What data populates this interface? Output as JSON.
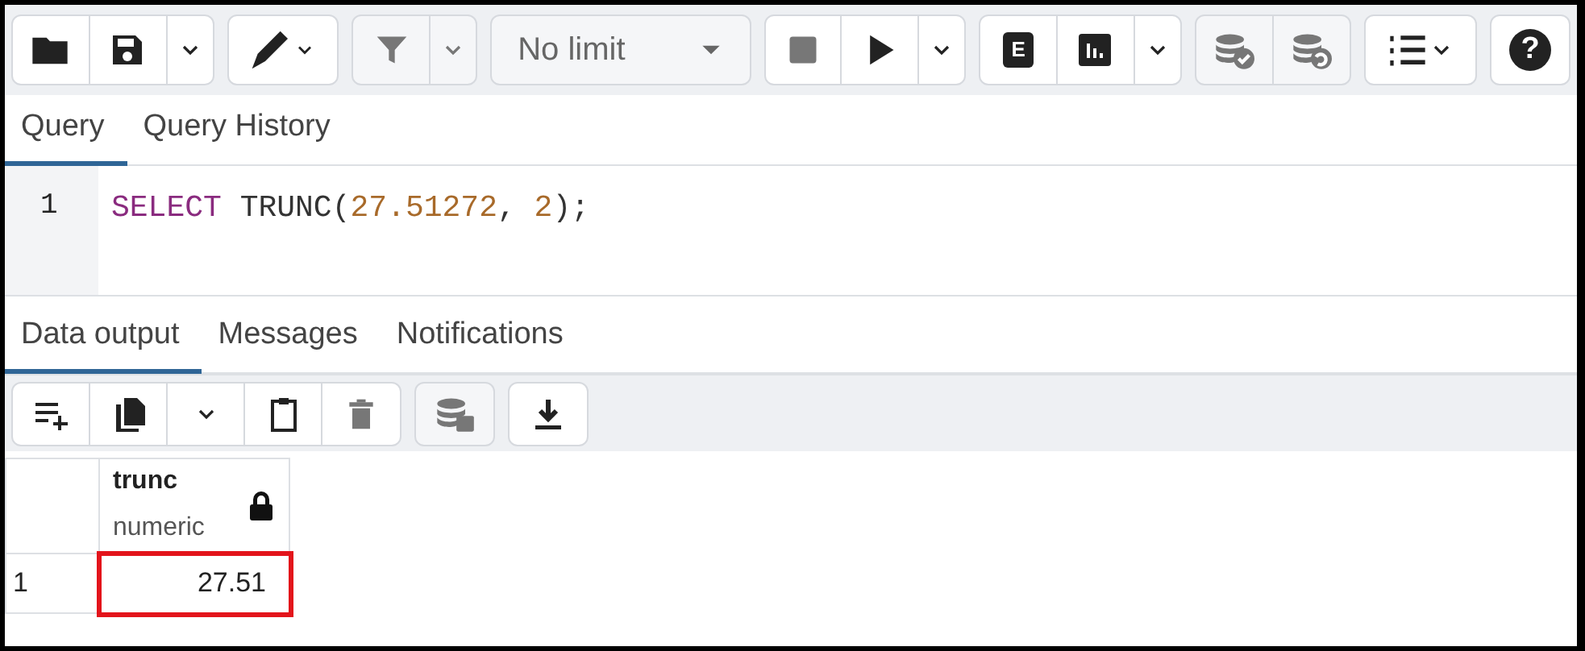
{
  "toolbar": {
    "groups": [
      {
        "buttons": [
          {
            "kind": "folder",
            "disabled": false
          },
          {
            "kind": "save",
            "disabled": false
          },
          {
            "kind": "caret",
            "disabled": false
          }
        ]
      },
      {
        "buttons": [
          {
            "kind": "pen-caret",
            "disabled": false
          }
        ]
      },
      {
        "buttons": [
          {
            "kind": "filter",
            "disabled": true
          },
          {
            "kind": "caret",
            "disabled": true
          }
        ]
      },
      {
        "buttons": [
          {
            "kind": "select",
            "label": "No limit",
            "disabled": true
          }
        ]
      },
      {
        "buttons": [
          {
            "kind": "stop",
            "disabled": true
          },
          {
            "kind": "play",
            "disabled": false
          },
          {
            "kind": "caret",
            "disabled": false
          }
        ]
      },
      {
        "buttons": [
          {
            "kind": "explain",
            "label": "E",
            "disabled": false
          },
          {
            "kind": "chart",
            "disabled": false
          },
          {
            "kind": "caret",
            "disabled": false
          }
        ]
      },
      {
        "buttons": [
          {
            "kind": "db-check",
            "disabled": true
          },
          {
            "kind": "db-undo",
            "disabled": true
          }
        ]
      },
      {
        "buttons": [
          {
            "kind": "list-caret",
            "disabled": false
          }
        ]
      },
      {
        "buttons": [
          {
            "kind": "help",
            "label": "?",
            "disabled": false
          }
        ]
      }
    ]
  },
  "query_tabs": [
    {
      "label": "Query",
      "selected": true
    },
    {
      "label": "Query History",
      "selected": false
    }
  ],
  "editor": {
    "lines": [
      {
        "number": "1",
        "tokens": [
          {
            "kind": "keyword",
            "text": "SELECT"
          },
          {
            "kind": "plain",
            "text": " TRUNC("
          },
          {
            "kind": "number",
            "text": "27.51272"
          },
          {
            "kind": "plain",
            "text": ", "
          },
          {
            "kind": "number",
            "text": "2"
          },
          {
            "kind": "plain",
            "text": ");"
          }
        ]
      }
    ]
  },
  "result_tabs": [
    {
      "label": "Data output",
      "selected": true
    },
    {
      "label": "Messages",
      "selected": false
    },
    {
      "label": "Notifications",
      "selected": false
    }
  ],
  "result_toolbar": {
    "groups": [
      {
        "buttons": [
          {
            "kind": "add-row",
            "disabled": false
          },
          {
            "kind": "copy",
            "disabled": false
          },
          {
            "kind": "caret",
            "disabled": false
          },
          {
            "kind": "paste",
            "disabled": false
          },
          {
            "kind": "delete",
            "disabled": true
          }
        ]
      },
      {
        "buttons": [
          {
            "kind": "db-save",
            "disabled": true
          }
        ]
      },
      {
        "buttons": [
          {
            "kind": "download",
            "disabled": false
          }
        ]
      }
    ]
  },
  "grid": {
    "columns": [
      {
        "name": "trunc",
        "type": "numeric",
        "locked": true
      }
    ],
    "rows": [
      {
        "number": "1",
        "cells": [
          {
            "text": "27.51",
            "highlighted": true
          }
        ]
      }
    ]
  }
}
